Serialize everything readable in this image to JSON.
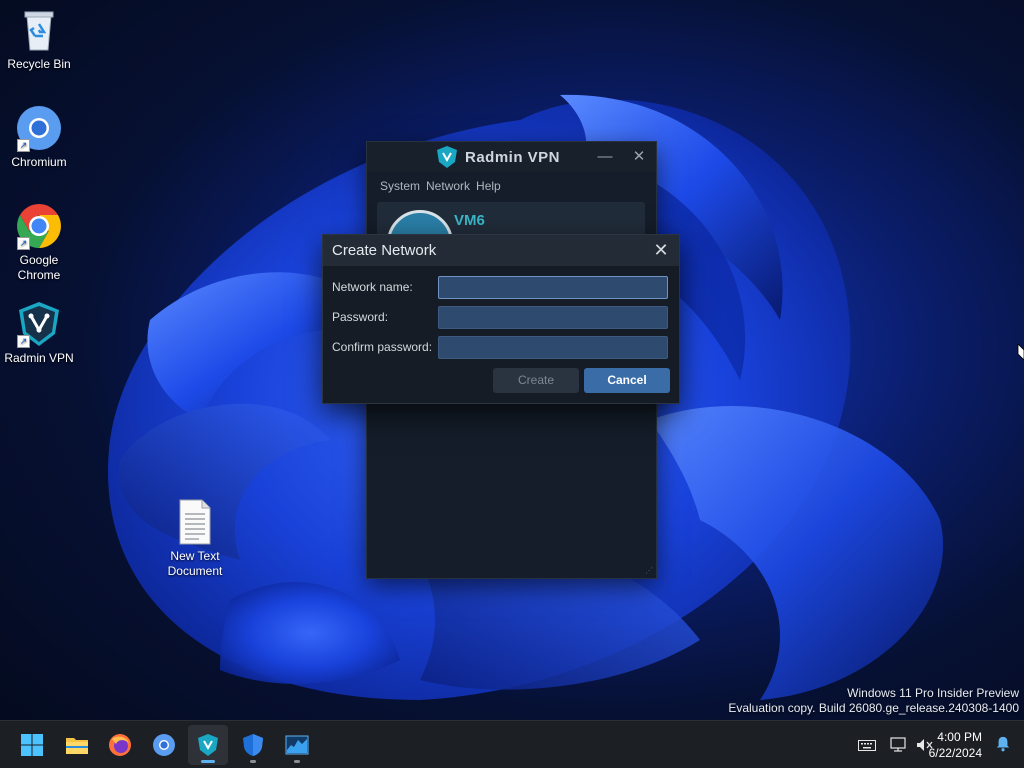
{
  "desktop": {
    "icons": [
      {
        "label": "Recycle Bin"
      },
      {
        "label": "Chromium"
      },
      {
        "label": "Google Chrome"
      },
      {
        "label": "Radmin VPN"
      },
      {
        "label": "New Text Document"
      }
    ],
    "watermark": {
      "line1": "Windows 11 Pro Insider Preview",
      "line2": "Evaluation copy. Build 26080.ge_release.240308-1400"
    }
  },
  "radmin": {
    "title": "Radmin VPN",
    "menu": [
      "System",
      "Network",
      "Help"
    ],
    "network_name": "VM6",
    "minimize_glyph": "—",
    "close_glyph": "✕"
  },
  "dialog": {
    "title": "Create Network",
    "close_glyph": "✕",
    "fields": [
      {
        "label": "Network name:",
        "value": ""
      },
      {
        "label": "Password:",
        "value": ""
      },
      {
        "label": "Confirm password:",
        "value": ""
      }
    ],
    "create_label": "Create",
    "cancel_label": "Cancel"
  },
  "taskbar": {
    "items": [
      "start-icon",
      "file-explorer-icon",
      "firefox-icon",
      "chromium-icon",
      "radmin-vpn-icon",
      "windows-security-icon",
      "resource-monitor-icon"
    ],
    "active_item": "radmin-vpn-icon",
    "clock": {
      "time": "4:00 PM",
      "date": "6/22/2024"
    }
  },
  "colors": {
    "accent": "#3a6da8",
    "radmin_teal": "#3bb8c9"
  }
}
